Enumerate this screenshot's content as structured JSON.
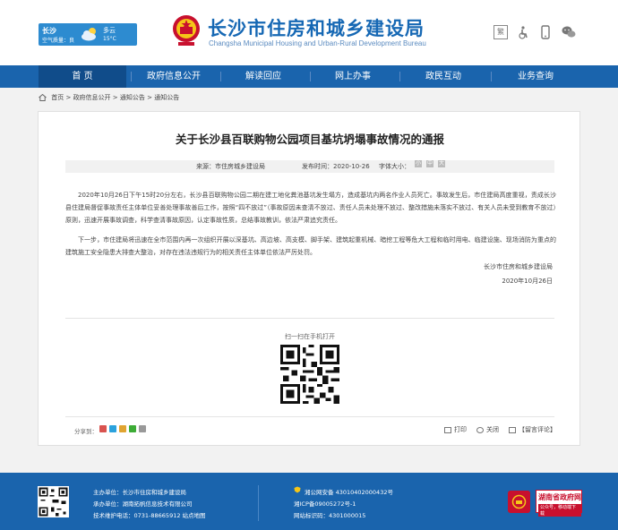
{
  "header": {
    "weather": {
      "city": "长沙",
      "air_quality": "空气质量：良",
      "condition": "多云",
      "temperature": "15°C"
    },
    "title": "长沙市住房和城乡建设局",
    "subtitle": "Changsha Municipal Housing and Urban-Rural Development Bureau",
    "icons": {
      "traditional": "繁"
    }
  },
  "nav": [
    {
      "label": "首 页"
    },
    {
      "label": "政府信息公开"
    },
    {
      "label": "解读回应"
    },
    {
      "label": "网上办事"
    },
    {
      "label": "政民互动"
    },
    {
      "label": "业务查询"
    }
  ],
  "breadcrumb": [
    "首页",
    "政府信息公开",
    "通知公告",
    "通知公告"
  ],
  "article": {
    "title": "关于长沙县百联购物公园项目基坑坍塌事故情况的通报",
    "source": "来源：市住房城乡建设局",
    "date": "发布时间：2020-10-26",
    "font_size_label": "字体大小：",
    "font_buttons": [
      "小",
      "中",
      "大"
    ],
    "paragraphs": [
      "2020年10月26日下午15时20分左右，长沙县百联购物公园二期在建工地化粪池基坑发生塌方，造成基坑内两名作业人员死亡。事故发生后，市住建局高度重视，责成长沙县住建局督促事故责任主体单位妥善处理事故善后工作，按照“四不放过”（事故原因未查清不放过、责任人员未处理不放过、整改措施未落实不放过、有关人员未受到教育不放过）原则，迅速开展事故调查，科学查清事故原因，认定事故性质，总结事故教训，依法严肃追究责任。",
      "下一步，市住建局将迅速在全市范围内再一次组织开展以深基坑、高边坡、高支模、脚手架、建筑起重机械、暗挖工程等危大工程和临时用电、临建设施、现场消防为重点的建筑施工安全隐患大排查大整治，对存在违法违规行为的相关责任主体单位依法严厉处罚。"
    ],
    "signature": "长沙市住房和城乡建设局",
    "signature_date": "2020年10月26日",
    "qr_caption": "扫一扫在手机打开",
    "share_label": "分享到：",
    "print_label": "打印",
    "close_label": "关闭",
    "comment_label": "【留言评论】"
  },
  "footer": {
    "host": "主办单位：长沙市住房和城乡建设局",
    "undertaker": "承办单位：湖南拓帆信息技术有限公司",
    "support": "技术维护电话：0731-88665912   站点地图",
    "police": "湘公网安备 43010402000432号",
    "icp": "湘ICP备09005272号-1",
    "site_id": "网站标识码：4301000015",
    "gov_name": "湖南省政府网",
    "gov_tag": "公众号，移动端下载"
  },
  "colors": {
    "brand_blue": "#1a64ad",
    "nav_active": "#104c8a",
    "gov_red": "#c8102e"
  }
}
